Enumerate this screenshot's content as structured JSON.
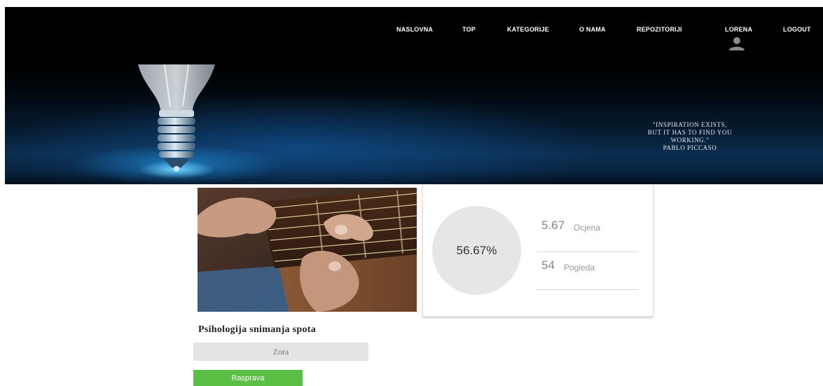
{
  "nav": {
    "items": [
      {
        "label": "NASLOVNA"
      },
      {
        "label": "TOP"
      },
      {
        "label": "KATEGORIJE"
      },
      {
        "label": "O NAMA"
      },
      {
        "label": "REPOZITORIJI"
      }
    ],
    "user_label": "LORENA",
    "user_icon": "user-icon",
    "logout_label": "LOGOUT"
  },
  "hero": {
    "quote_lines": [
      "\"INSPIRATION EXISTS,",
      "BUT IT HAS TO FIND YOU",
      "WORKING.\""
    ],
    "quote_author": "PABLO PICCASO"
  },
  "stats": {
    "percent_text": "56.67%",
    "percent_value": 56.67,
    "rating_value": "5.67",
    "rating_label": "Ocjena",
    "views_value": "54",
    "views_label": "Pogleda"
  },
  "post": {
    "title": "Psihologija snimanja spota",
    "author": "Zora",
    "discussion_label": "Rasprava"
  },
  "colors": {
    "header_bg": "#000000",
    "accent_blue": "#1e8fe0",
    "button_green": "#5cbf45",
    "circle_grey": "#e6e6e6"
  }
}
